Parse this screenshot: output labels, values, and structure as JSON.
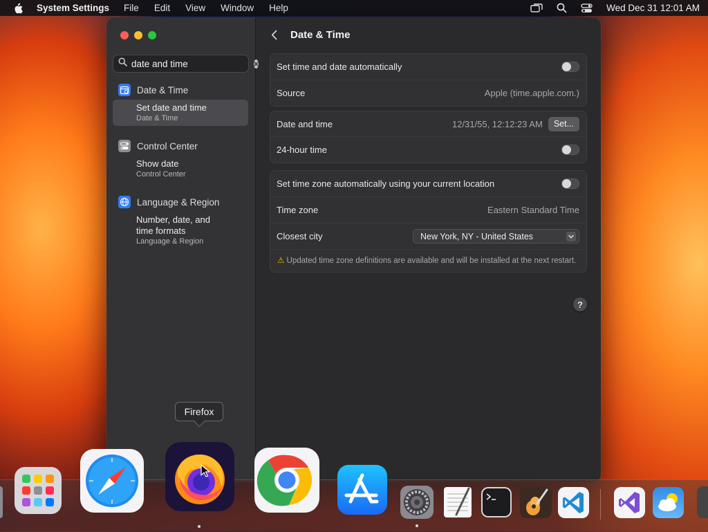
{
  "menubar": {
    "app_name": "System Settings",
    "menus": [
      "File",
      "Edit",
      "View",
      "Window",
      "Help"
    ],
    "clock": "Wed Dec 31  12:01 AM"
  },
  "sidebar": {
    "search": {
      "value": "date and time",
      "placeholder": "Search"
    },
    "results": [
      {
        "title": "Date & Time",
        "icon": "calendar-clock-icon",
        "items": [
          {
            "label": "Set date and time",
            "sub": "Date & Time",
            "selected": true
          }
        ]
      },
      {
        "title": "Control Center",
        "icon": "control-center-icon",
        "items": [
          {
            "label": "Show date",
            "sub": "Control Center",
            "selected": false
          }
        ]
      },
      {
        "title": "Language & Region",
        "icon": "globe-icon",
        "items": [
          {
            "label": "Number, date, and time formats",
            "sub": "Language & Region",
            "selected": false
          }
        ]
      }
    ]
  },
  "content": {
    "title": "Date & Time",
    "auto_time": {
      "label": "Set time and date automatically",
      "enabled": false
    },
    "source": {
      "label": "Source",
      "value": "Apple (time.apple.com.)"
    },
    "date_time": {
      "label": "Date and time",
      "value": "12/31/55, 12:12:23 AM",
      "button": "Set..."
    },
    "hour24": {
      "label": "24-hour time",
      "enabled": false
    },
    "auto_timezone": {
      "label": "Set time zone automatically using your current location",
      "enabled": false
    },
    "timezone": {
      "label": "Time zone",
      "value": "Eastern Standard Time"
    },
    "closest_city": {
      "label": "Closest city",
      "value": "New York, NY - United States"
    },
    "notice": "Updated time zone definitions are available and will be installed at the next restart.",
    "help": "?"
  },
  "dock": {
    "tooltip": "Firefox",
    "apps": [
      "Launchpad",
      "Safari",
      "Firefox",
      "Google Chrome",
      "App Store",
      "System Settings",
      "TextEdit",
      "Terminal",
      "GarageBand",
      "Visual Studio Code",
      "Visual Studio",
      "Weather"
    ]
  },
  "colors": {
    "close": "#fe5f57",
    "minimize": "#febc2e",
    "maximize": "#28c840",
    "accent": "#0a84ff"
  }
}
